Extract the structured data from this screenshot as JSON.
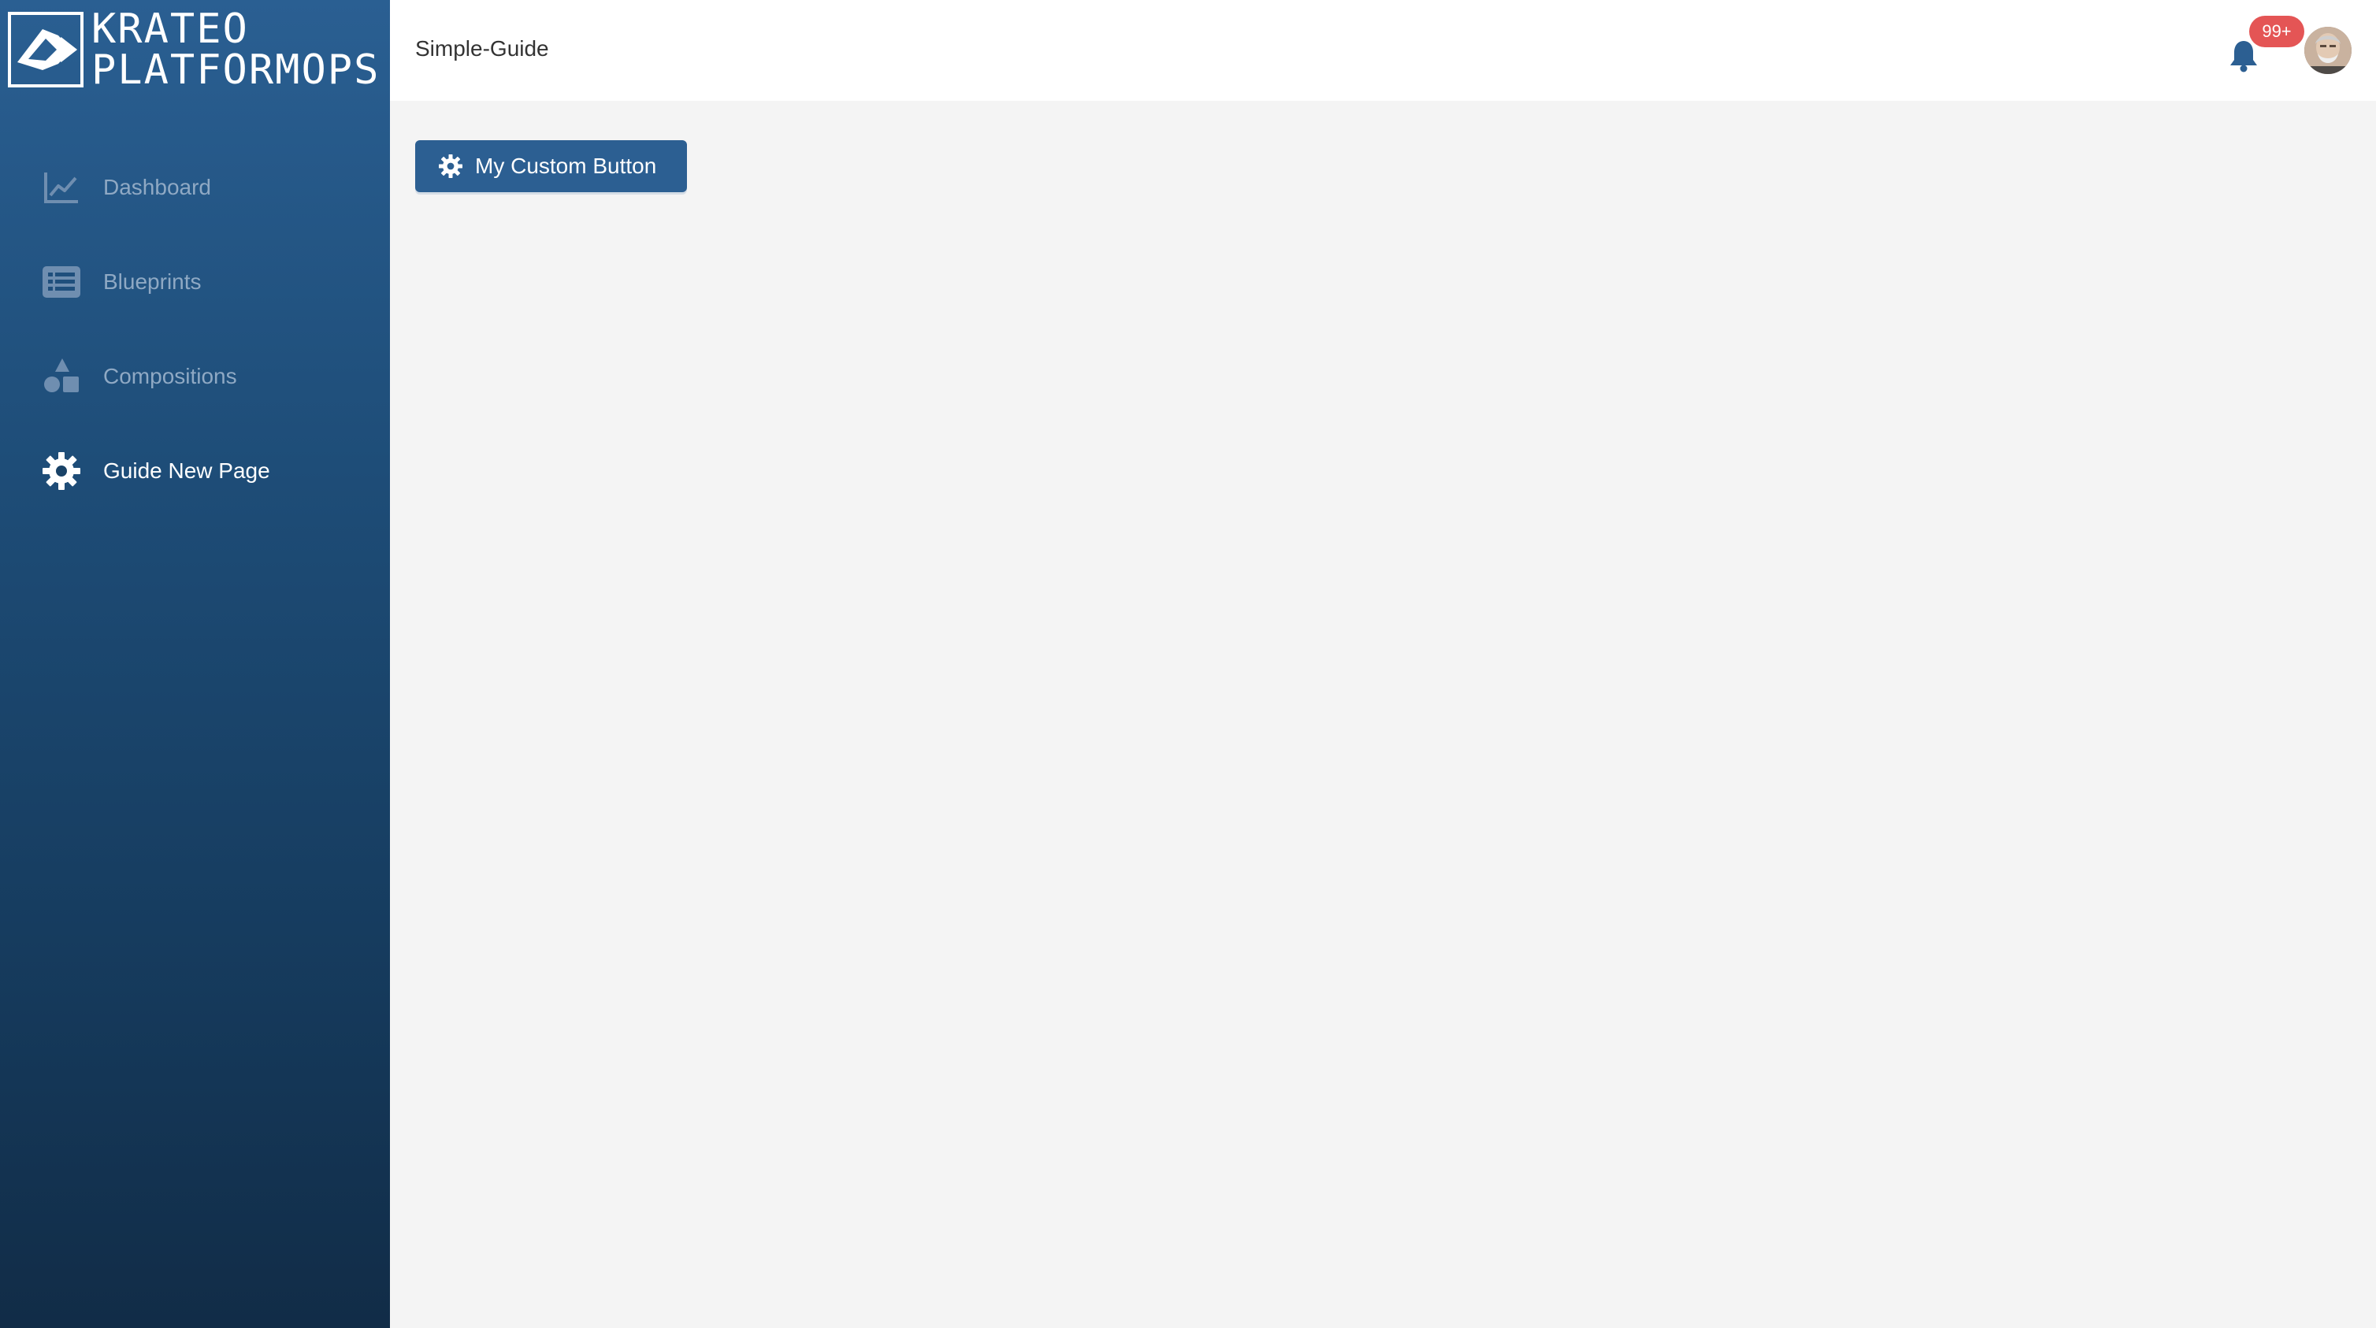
{
  "brand": {
    "line1": "KRATEO",
    "line2": "PLATFORMOPS",
    "logo_icon": "krateo-logo-icon"
  },
  "sidebar": {
    "items": [
      {
        "label": "Dashboard",
        "icon": "line-chart-icon",
        "active": false
      },
      {
        "label": "Blueprints",
        "icon": "list-icon",
        "active": false
      },
      {
        "label": "Compositions",
        "icon": "shapes-icon",
        "active": false
      },
      {
        "label": "Guide New Page",
        "icon": "gear-icon",
        "active": true
      }
    ]
  },
  "header": {
    "title": "Simple-Guide",
    "notifications": {
      "icon": "bell-icon",
      "badge": "99+"
    },
    "avatar": "user-avatar"
  },
  "main": {
    "custom_button": {
      "label": "My Custom Button",
      "icon": "gear-icon"
    }
  },
  "colors": {
    "sidebar_top": "#2a5f92",
    "sidebar_bottom": "#112c47",
    "accent": "#2c5f92",
    "badge": "#e45555",
    "nav_inactive": "#8fa9c4",
    "background": "#f4f4f4"
  }
}
